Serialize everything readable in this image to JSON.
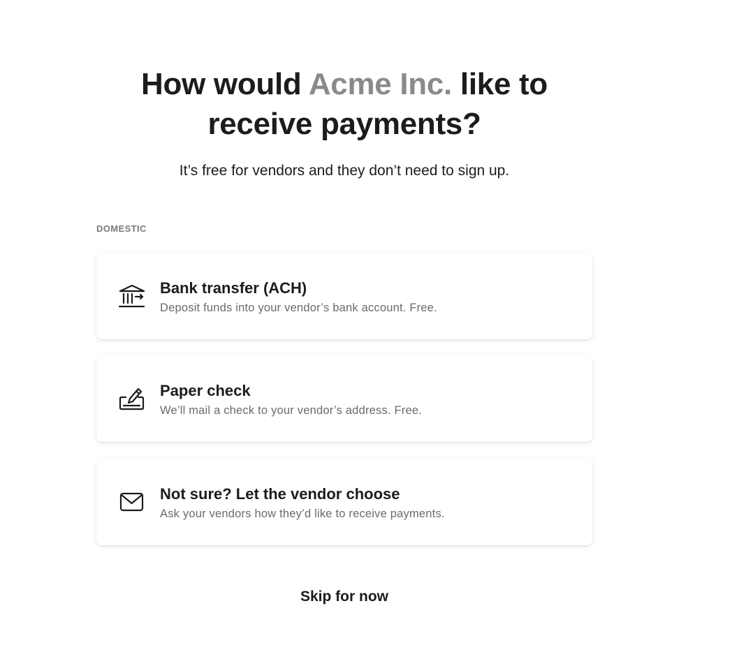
{
  "header": {
    "title_prefix": "How would",
    "vendor_name": "Acme Inc.",
    "title_suffix": "like to receive payments?",
    "subtitle": "It’s free for vendors and they don’t need to sign up."
  },
  "section": {
    "label": "DOMESTIC"
  },
  "options": [
    {
      "icon": "bank-icon",
      "title": "Bank transfer (ACH)",
      "description": "Deposit funds into your vendor’s bank account. Free."
    },
    {
      "icon": "check-pen-icon",
      "title": "Paper check",
      "description": "We’ll mail a check to your vendor’s address. Free."
    },
    {
      "icon": "envelope-icon",
      "title": "Not sure? Let the vendor choose",
      "description": "Ask your vendors how they’d like to receive payments."
    }
  ],
  "footer": {
    "skip_label": "Skip for now"
  },
  "colors": {
    "text": "#1c1c1c",
    "muted_title": "#8a8a8a",
    "description": "#6b6b6b",
    "section_label": "#7a7a7a",
    "background": "#ffffff"
  }
}
